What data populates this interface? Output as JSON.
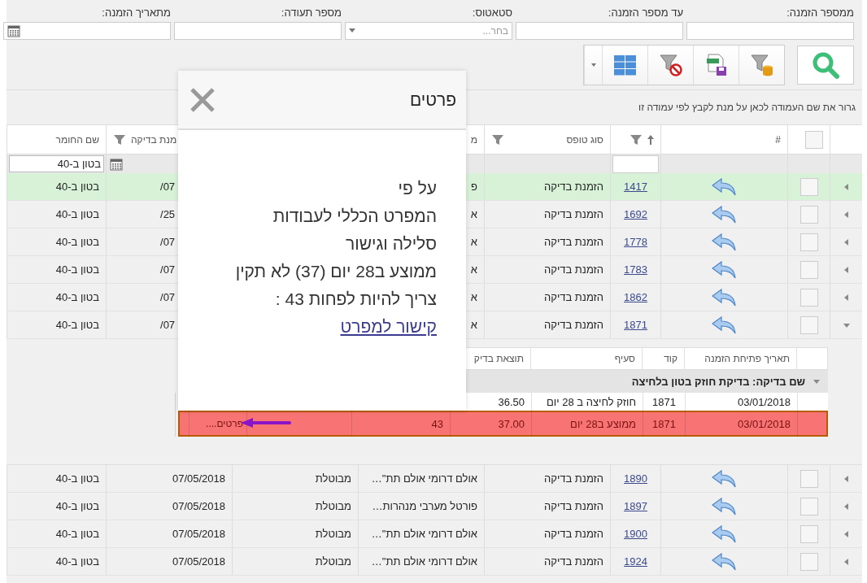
{
  "filters": [
    {
      "label": "ממספר הזמנה:",
      "kind": "text"
    },
    {
      "label": "עד מספר הזמנה:",
      "kind": "text"
    },
    {
      "label": "סטאטוס:",
      "kind": "select",
      "placeholder": "בחר..."
    },
    {
      "label": "מספר תעודה:",
      "kind": "text"
    },
    {
      "label": "מתאריך הזמנה:",
      "kind": "date"
    }
  ],
  "group_panel": {
    "hint": "גרור את שם העמודה לכאן על מנת לקבץ לפי עמודה זו"
  },
  "table": {
    "header": {
      "select_all": {
        "checked": false
      },
      "index_label": "#",
      "order": {
        "sorted_ascending": true,
        "filter": true
      },
      "form_type": {
        "label": "סוג טופס",
        "filter": true
      },
      "location": {
        "label": "מ"
      },
      "date": {
        "label": "מנת בדיקה",
        "filter": true
      },
      "material": {
        "label": "שם החומר"
      }
    },
    "filter_row": {
      "material": "בטון ב-40"
    },
    "rows": [
      {
        "selected": true,
        "expanded": false,
        "checked": false,
        "order": "1417",
        "form_type": "הזמנת בדיקה",
        "location": "פ",
        "date": "07/",
        "material": "בטון ב-40"
      },
      {
        "selected": false,
        "expanded": false,
        "checked": false,
        "order": "1692",
        "form_type": "הזמנת בדיקה",
        "location": "א",
        "date": "25/",
        "material": "בטון ב-40"
      },
      {
        "selected": false,
        "expanded": false,
        "checked": false,
        "order": "1778",
        "form_type": "הזמנת בדיקה",
        "location": "א",
        "date": "07/",
        "material": "בטון ב-40"
      },
      {
        "selected": false,
        "expanded": false,
        "checked": false,
        "order": "1783",
        "form_type": "הזמנת בדיקה",
        "location": "א",
        "date": "07/",
        "material": "בטון ב-40"
      },
      {
        "selected": false,
        "expanded": false,
        "checked": false,
        "order": "1862",
        "form_type": "הזמנת בדיקה",
        "location": "א",
        "date": "07/",
        "material": "בטון ב-40"
      },
      {
        "selected": false,
        "expanded": true,
        "checked": false,
        "order": "1871",
        "form_type": "הזמנת בדיקה",
        "location": "א",
        "date": "07/",
        "material": "בטון ב-40",
        "detail": {
          "columns": [
            "תאריך פתיחת הזמנה",
            "קוד",
            "סעיף",
            "תוצאת בדיק"
          ],
          "group": {
            "label": "שם בדיקה: בדיקת חוזק בטון בלחיצה",
            "expanded": true
          },
          "rows": [
            {
              "highlighted": false,
              "date": "03/01/2018",
              "code": "1871",
              "section": "חוזק לחיצה ב 28 יום",
              "result": "36.50"
            },
            {
              "highlighted": true,
              "date": "03/01/2018",
              "code": "1871",
              "section": "ממוצע ב28 יום",
              "result": "37.00",
              "required": "43",
              "details": "פרטים....",
              "pointer": true
            }
          ]
        }
      },
      {
        "selected": false,
        "expanded": false,
        "checked": false,
        "order": "1890",
        "form_type": "הזמנת בדיקה",
        "location": "אולם דרומי אולם תת\"…",
        "status": "מבוטלת",
        "date": "07/05/2018",
        "material": "בטון ב-40"
      },
      {
        "selected": false,
        "expanded": false,
        "checked": false,
        "order": "1897",
        "form_type": "הזמנת בדיקה",
        "location": "פורטל מערבי מנהרות…",
        "status": "מבוטלת",
        "date": "07/05/2018",
        "material": "בטון ב-40"
      },
      {
        "selected": false,
        "expanded": false,
        "checked": false,
        "order": "1900",
        "form_type": "הזמנת בדיקה",
        "location": "אולם דרומי אולם תת\"…",
        "status": "מבוטלת",
        "date": "07/05/2018",
        "material": "בטון ב-40"
      },
      {
        "selected": false,
        "expanded": false,
        "checked": false,
        "order": "1924",
        "form_type": "הזמנת בדיקה",
        "location": "אולם דרומי אולם תת\"…",
        "status": "מבוטלת",
        "date": "07/05/2018",
        "material": "בטון ב-40"
      }
    ]
  },
  "modal": {
    "title": "פרטים",
    "lines": [
      "על פי",
      "המפרט הכללי לעבודות",
      "סלילה וגישור",
      "ממוצע ב28 יום (37)  לא תקין",
      "צריך להיות לפחות 43 :"
    ],
    "link": "קישור למפרט"
  }
}
